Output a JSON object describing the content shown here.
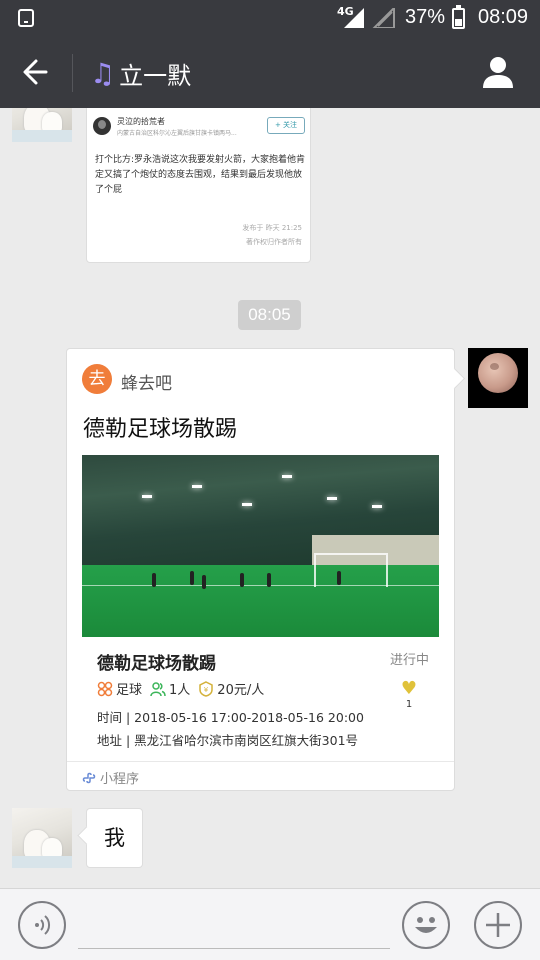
{
  "status_bar": {
    "network": "4G",
    "battery_percent": "37%",
    "time": "08:09"
  },
  "header": {
    "title": "立一默",
    "title_icon": "music-note-icon"
  },
  "article_card": {
    "author": "灵泣的拾荒者",
    "location": "内蒙古自治区科尔沁左翼后旗甘旗卡镇两马...",
    "follow_label": "+ 关注",
    "body": "打个比方:罗永浩说这次我要发射火箭，大家抱着他肯定又搞了个炮仗的态度去围观，结果到最后发现他放了个屁",
    "date": "发布于 昨天 21:25",
    "copyright": "著作权归作者所有"
  },
  "timestamp": "08:05",
  "mini_program": {
    "logo_char": "去",
    "source": "蜂去吧",
    "title": "德勒足球场散踢",
    "event_title": "德勒足球场散踢",
    "status": "进行中",
    "tags": [
      {
        "icon": "sport-icon",
        "label": "足球"
      },
      {
        "icon": "people-icon",
        "label": "1人"
      },
      {
        "icon": "price-icon",
        "label": "20元/人"
      }
    ],
    "likes": "1",
    "time_line": "时间 | 2018-05-16 17:00-2018-05-16 20:00",
    "address_line": "地址 |  黑龙江省哈尔滨市南岗区红旗大街301号",
    "footer_label": "小程序"
  },
  "last_message": "我",
  "colors": {
    "header_bg": "#393a3f",
    "chat_bg": "#ebebeb",
    "mp_logo": "#f07d3a",
    "accent_heart": "#e0c23a"
  }
}
